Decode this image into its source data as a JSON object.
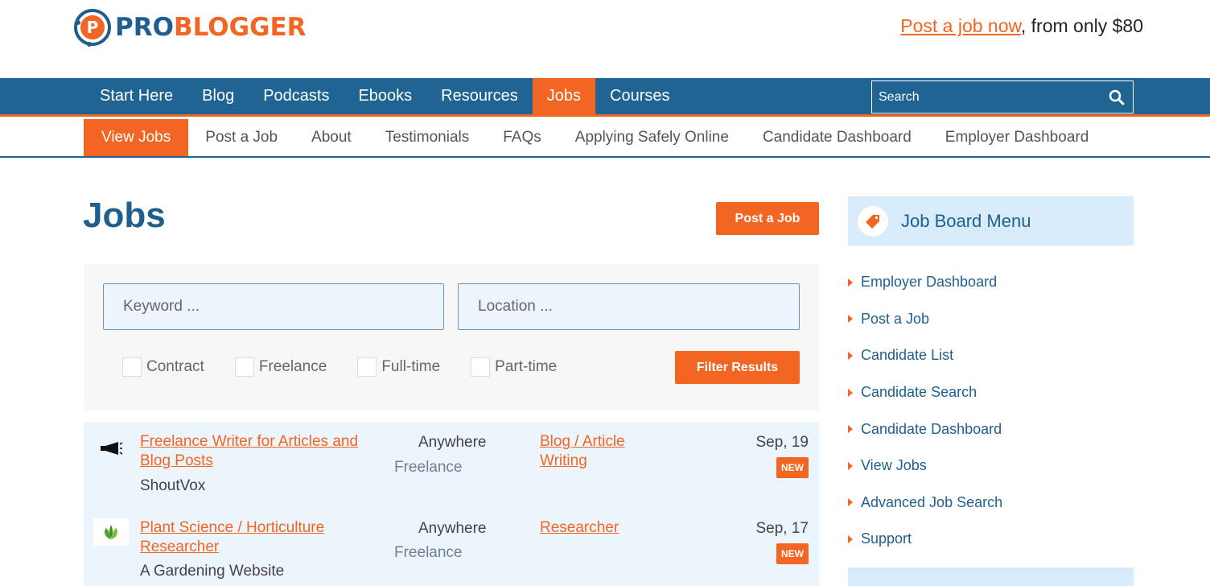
{
  "header": {
    "logo_pro": "PRO",
    "logo_blogger": "BLOGGER",
    "promo_link": "Post a job now",
    "promo_rest": ", from only $80"
  },
  "main_nav": {
    "items": [
      "Start Here",
      "Blog",
      "Podcasts",
      "Ebooks",
      "Resources",
      "Jobs",
      "Courses"
    ],
    "active": "Jobs",
    "search_placeholder": "Search"
  },
  "sub_nav": {
    "items": [
      "View Jobs",
      "Post a Job",
      "About",
      "Testimonials",
      "FAQs",
      "Applying Safely Online",
      "Candidate Dashboard",
      "Employer Dashboard"
    ],
    "active": "View Jobs"
  },
  "page": {
    "title": "Jobs",
    "post_job_button": "Post a Job"
  },
  "filters": {
    "keyword_placeholder": "Keyword ...",
    "location_placeholder": "Location ...",
    "types": [
      "Contract",
      "Freelance",
      "Full-time",
      "Part-time"
    ],
    "submit": "Filter Results"
  },
  "jobs": [
    {
      "title": "Freelance Writer for Articles and Blog Posts",
      "company": "ShoutVox",
      "location": "Anywhere",
      "type": "Freelance",
      "category": "Blog / Article Writing",
      "date": "Sep, 19",
      "badge": "NEW",
      "logo_icon": "megaphone-icon"
    },
    {
      "title": "Plant Science / Horticulture Researcher",
      "company": "A Gardening Website",
      "location": "Anywhere",
      "type": "Freelance",
      "category": "Researcher",
      "date": "Sep, 17",
      "badge": "NEW",
      "logo_icon": "leaf-icon"
    }
  ],
  "sidebar": {
    "title": "Job Board Menu",
    "items": [
      "Employer Dashboard",
      "Post a Job",
      "Candidate List",
      "Candidate Search",
      "Candidate Dashboard",
      "View Jobs",
      "Advanced Job Search",
      "Support"
    ]
  },
  "colors": {
    "brand_blue": "#1f6493",
    "brand_orange": "#f26522"
  }
}
